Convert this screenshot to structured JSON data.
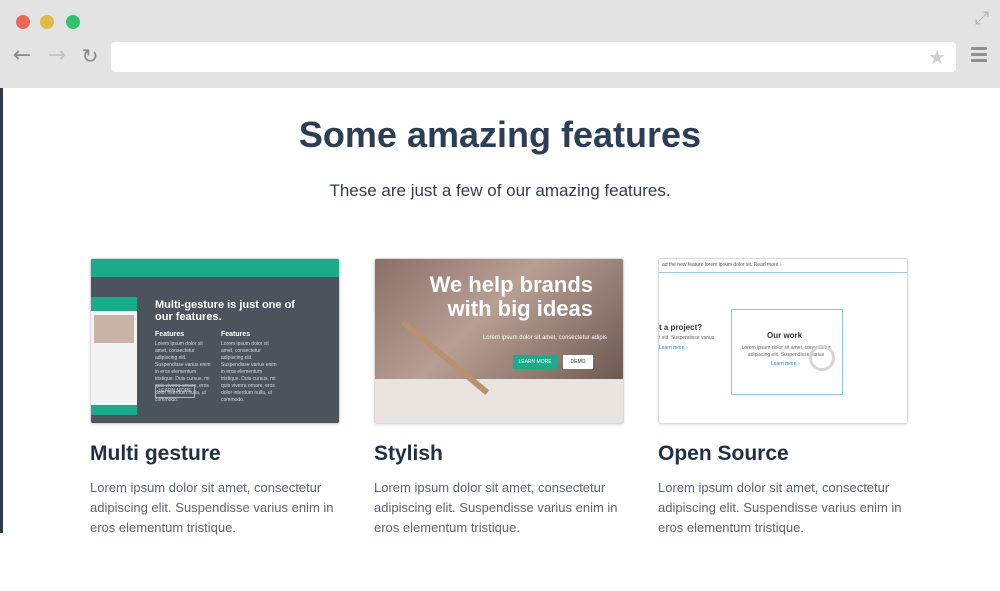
{
  "browser": {
    "url": "",
    "icons": {
      "back": "back-arrow-icon",
      "forward": "forward-arrow-icon",
      "reload": "reload-icon",
      "bookmark": "star-icon",
      "menu": "hamburger-menu-icon",
      "expand": "expand-icon"
    },
    "colors": {
      "close": "#ec6559",
      "minimize": "#dcbc45",
      "maximize": "#33c26b"
    }
  },
  "page": {
    "title": "Some amazing features",
    "subtitle": "These are just a few of our amazing features."
  },
  "features": [
    {
      "title": "Multi gesture",
      "text": "Lorem ipsum dolor sit amet, consectetur adipiscing elit. Suspendisse varius enim in eros elementum tristique.",
      "thumb": {
        "heading": "Multi-gesture is just one of our features.",
        "col1": "Features",
        "col2": "Features",
        "body": "Lorem ipsum dolor sit amet, consectetur adipiscing elit. Suspendisse varius enim in eros elementum tristique. Duis cursus, mi quis viverra ornare, eros dolor interdum nulla, ut commodo.",
        "button": "LEARN MORE"
      }
    },
    {
      "title": "Stylish",
      "text": "Lorem ipsum dolor sit amet, consectetur adipiscing elit. Suspendisse varius enim in eros elementum tristique.",
      "thumb": {
        "heading": "We help brands with big ideas",
        "sub": "Lorem ipsum dolor sit amet, consectetur adipis",
        "button1": "LEARN MORE",
        "button2": "DEMO"
      }
    },
    {
      "title": "Open Source",
      "text": "Lorem ipsum dolor sit amet, consectetur adipiscing elit. Suspendisse varius enim in eros elementum tristique.",
      "thumb": {
        "topline": "ad the new feature lorem ipsum dolor sit. Read more ›",
        "left_heading": "t a project?",
        "left_text": "t elit. Suspendisse varius",
        "left_link": "Learn more ›",
        "heading": "Our work",
        "body": "Lorem ipsum dolor sit amet, consectetur adipiscing elit. Suspendisse varius",
        "link": "Learn more ›"
      }
    }
  ]
}
